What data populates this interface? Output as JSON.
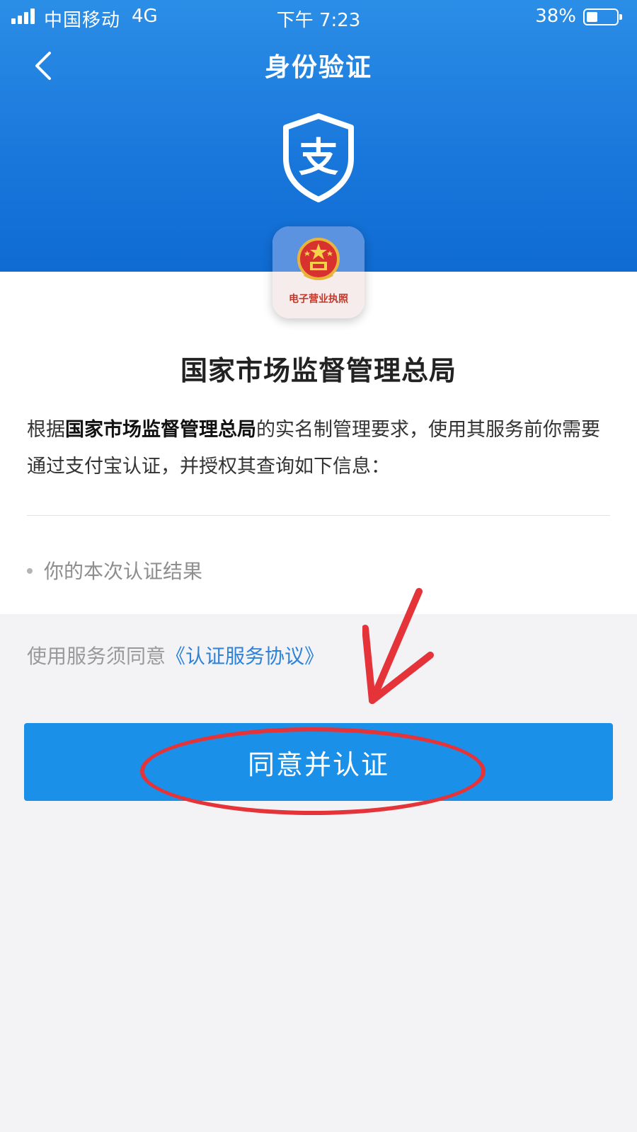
{
  "status_bar": {
    "carrier": "中国移动",
    "network": "4G",
    "time": "下午 7:23",
    "battery_percent": "38%",
    "battery_level": 0.38,
    "signal_icon": "signal-bars-icon",
    "battery_icon": "battery-icon"
  },
  "nav": {
    "title": "身份验证",
    "back_icon": "chevron-left-icon"
  },
  "brand": {
    "logo_glyph": "支",
    "logo_icon": "alipay-shield-icon"
  },
  "app_icon": {
    "label": "电子营业执照",
    "emblem_icon": "national-emblem-icon"
  },
  "organization": "国家市场监督管理总局",
  "intro": {
    "prefix": "根据",
    "org_bold": "国家市场监督管理总局",
    "suffix": "的实名制管理要求，使用其服务前你需要通过支付宝认证，并授权其查询如下信息："
  },
  "info_items": [
    "你的本次认证结果"
  ],
  "agreement": {
    "prefix": "使用服务须同意",
    "link": "《认证服务协议》"
  },
  "confirm_button": "同意并认证",
  "colors": {
    "header": "#1a78dc",
    "button": "#1a90e8",
    "link": "#2e82d8",
    "annotation": "#e5333a"
  },
  "annotations": {
    "arrow_icon": "red-arrow-icon",
    "circle_icon": "red-circle-highlight"
  }
}
